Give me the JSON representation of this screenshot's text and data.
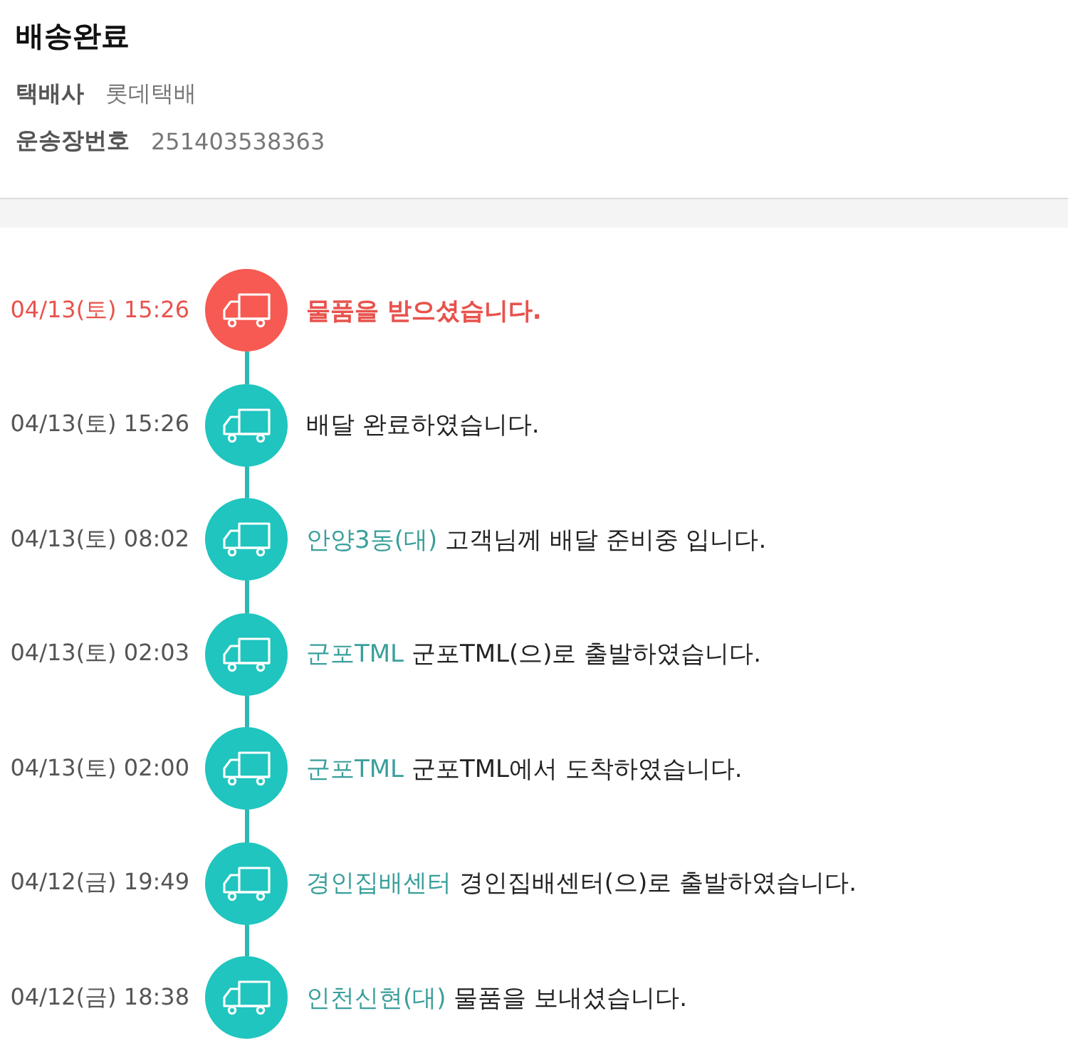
{
  "header": {
    "title": "배송완료",
    "fields": [
      {
        "label": "택배사",
        "value": "롯데택배"
      },
      {
        "label": "운송장번호",
        "value": "251403538363"
      }
    ]
  },
  "events": [
    {
      "time": "04/13(토) 15:26",
      "message": "물품을 받으셨습니다.",
      "current": true
    },
    {
      "time": "04/13(토) 15:26",
      "message": "배달 완료하였습니다.",
      "current": false
    },
    {
      "time": "04/13(토) 08:02",
      "location": "안양3동(대)",
      "message": "고객님께 배달 준비중 입니다.",
      "current": false
    },
    {
      "time": "04/13(토) 02:03",
      "location": "군포TML",
      "message": "군포TML(으)로 출발하였습니다.",
      "current": false
    },
    {
      "time": "04/13(토) 02:00",
      "location": "군포TML",
      "message": "군포TML에서 도착하였습니다.",
      "current": false
    },
    {
      "time": "04/12(금) 19:49",
      "location": "경인집배센터",
      "message": "경인집배센터(으)로 출발하였습니다.",
      "current": false
    },
    {
      "time": "04/12(금) 18:38",
      "location": "인천신현(대)",
      "message": "물품을 보내셨습니다.",
      "current": false
    }
  ]
}
